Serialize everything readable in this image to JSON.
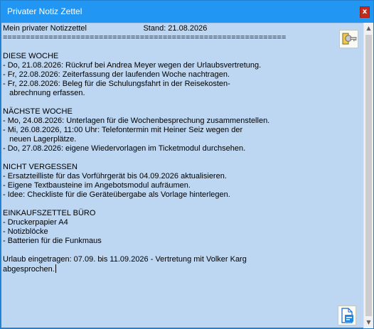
{
  "window": {
    "title": "Privater Notiz Zettel",
    "close_label": "x"
  },
  "editor": {
    "lines": [
      "Mein privater Notizzettel                          Stand: 21.08.2026",
      "==============================================================",
      "",
      "DIESE WOCHE",
      "- Do, 21.08.2026: Rückruf bei Andrea Meyer wegen der Urlaubsvertretung.",
      "- Fr, 22.08.2026: Zeiterfassung der laufenden Woche nachtragen.",
      "- Fr, 22.08.2026: Beleg für die Schulungsfahrt in der Reisekosten-",
      "   abrechnung erfassen.",
      "",
      "NÄCHSTE WOCHE",
      "- Mo, 24.08.2026: Unterlagen für die Wochenbesprechung zusammenstellen.",
      "- Mi, 26.08.2026, 11:00 Uhr: Telefontermin mit Heiner Seiz wegen der",
      "   neuen Lagerplätze.",
      "- Do, 27.08.2026: eigene Wiedervorlagen im Ticketmodul durchsehen.",
      "",
      "NICHT VERGESSEN",
      "- Ersatzteilliste für das Vorführgerät bis 04.09.2026 aktualisieren.",
      "- Eigene Textbausteine im Angebotsmodul aufräumen.",
      "- Idee: Checkliste für die Geräteübergabe als Vorlage hinterlegen.",
      "",
      "EINKAUFSZETTEL BÜRO",
      "- Druckerpapier A4",
      "- Notizblöcke",
      "- Batterien für die Funkmaus",
      "",
      "Urlaub eingetragen: 07.09. bis 11.09.2026 - Vertretung mit Volker Karg",
      "abgesprochen."
    ]
  },
  "icons": {
    "key_button": "key-icon",
    "document_button": "document-icon"
  },
  "colors": {
    "titlebar": "#2196f3",
    "editor_background": "#bdd6f1",
    "close_button": "#c42b1c"
  }
}
